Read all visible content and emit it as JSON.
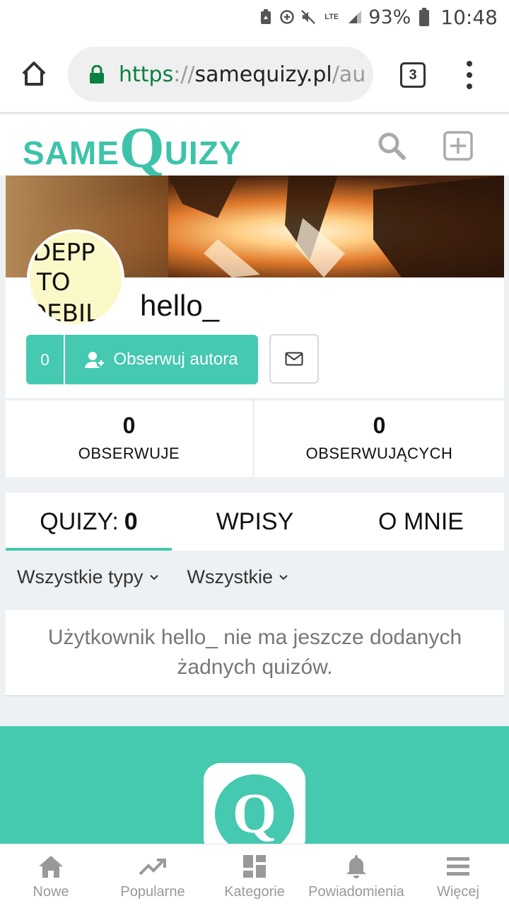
{
  "status_bar": {
    "lte": "LTE",
    "battery": "93%",
    "time": "10:48"
  },
  "browser": {
    "url_scheme": "https",
    "url_separator": "://",
    "url_host": "samequizy.pl",
    "url_path": "/au",
    "tab_count": "3"
  },
  "site": {
    "logo_same": "SAME",
    "logo_q": "Q",
    "logo_uizy": "UIZY",
    "accent_color": "#45c9b0"
  },
  "profile": {
    "avatar_text_lines": [
      "DEPP",
      "TO",
      "DEBIL"
    ],
    "username": "hello_",
    "follow_count": "0",
    "follow_label": "Obserwuj autora"
  },
  "stats": [
    {
      "value": "0",
      "label": "OBSERWUJE"
    },
    {
      "value": "0",
      "label": "OBSERWUJĄCYCH"
    }
  ],
  "tabs": {
    "quizy_label": "QUIZY:",
    "quizy_count": "0",
    "wpisy": "WPISY",
    "o_mnie": "O MNIE"
  },
  "filters": {
    "type": "Wszystkie typy",
    "scope": "Wszystkie"
  },
  "empty_message": "Użytkownik hello_ nie ma jeszcze dodanych żadnych quizów.",
  "bottom_nav": [
    {
      "label": "Nowe",
      "icon": "home-icon"
    },
    {
      "label": "Popularne",
      "icon": "trending-icon"
    },
    {
      "label": "Kategorie",
      "icon": "categories-icon"
    },
    {
      "label": "Powiadomienia",
      "icon": "bell-icon"
    },
    {
      "label": "Więcej",
      "icon": "menu-icon"
    }
  ]
}
